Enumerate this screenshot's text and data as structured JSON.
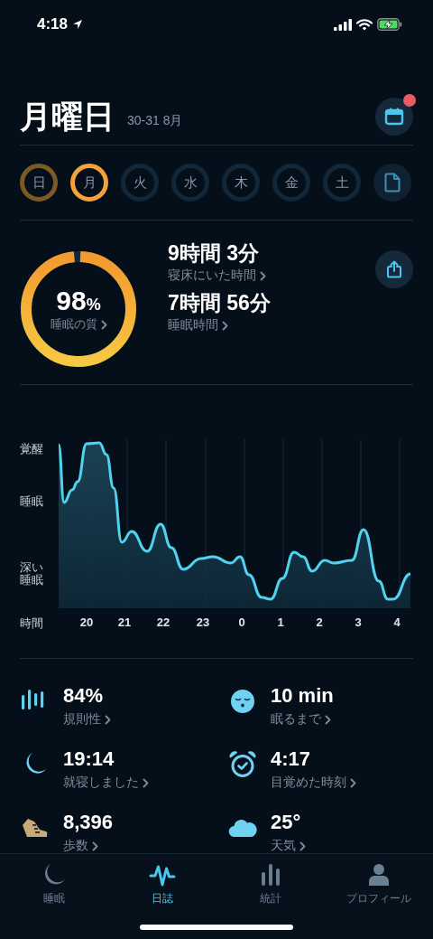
{
  "status_bar": {
    "time": "4:18"
  },
  "header": {
    "title": "月曜日",
    "date_range": "30-31 8月",
    "calendar_badge": true
  },
  "days": [
    {
      "label": "日",
      "recorded": true,
      "selected": false
    },
    {
      "label": "月",
      "recorded": true,
      "selected": true
    },
    {
      "label": "火",
      "recorded": false,
      "selected": false
    },
    {
      "label": "水",
      "recorded": false,
      "selected": false
    },
    {
      "label": "木",
      "recorded": false,
      "selected": false
    },
    {
      "label": "金",
      "recorded": false,
      "selected": false
    },
    {
      "label": "土",
      "recorded": false,
      "selected": false
    }
  ],
  "summary": {
    "quality": {
      "value": "98",
      "unit": "%",
      "label": "睡眠の質",
      "level": 0.98
    },
    "metrics": [
      {
        "value": "9時間 3分",
        "label": "寝床にいた時間"
      },
      {
        "value": "7時間 56分",
        "label": "睡眠時間"
      }
    ]
  },
  "chart": {
    "y_labels": [
      "覚醒",
      "睡眠",
      "深い睡眠"
    ],
    "x_title": "時間",
    "x_labels": [
      "20",
      "21",
      "22",
      "23",
      "0",
      "1",
      "2",
      "3",
      "4"
    ]
  },
  "stats": [
    {
      "kind": "regularity",
      "value": "84%",
      "label": "規則性"
    },
    {
      "kind": "asleep",
      "value": "10 min",
      "label": "眠るまで"
    },
    {
      "kind": "bedtime",
      "value": "19:14",
      "label": "就寝しました"
    },
    {
      "kind": "wake",
      "value": "4:17",
      "label": "目覚めた時刻"
    },
    {
      "kind": "steps",
      "value": "8,396",
      "label": "歩数"
    },
    {
      "kind": "weather",
      "value": "25°",
      "label": "天気"
    }
  ],
  "tabs": [
    {
      "kind": "sleep",
      "label": "睡眠",
      "selected": false
    },
    {
      "kind": "journal",
      "label": "日誌",
      "selected": true
    },
    {
      "kind": "stats",
      "label": "統計",
      "selected": false
    },
    {
      "kind": "profile",
      "label": "プロフィール",
      "selected": false
    }
  ]
}
